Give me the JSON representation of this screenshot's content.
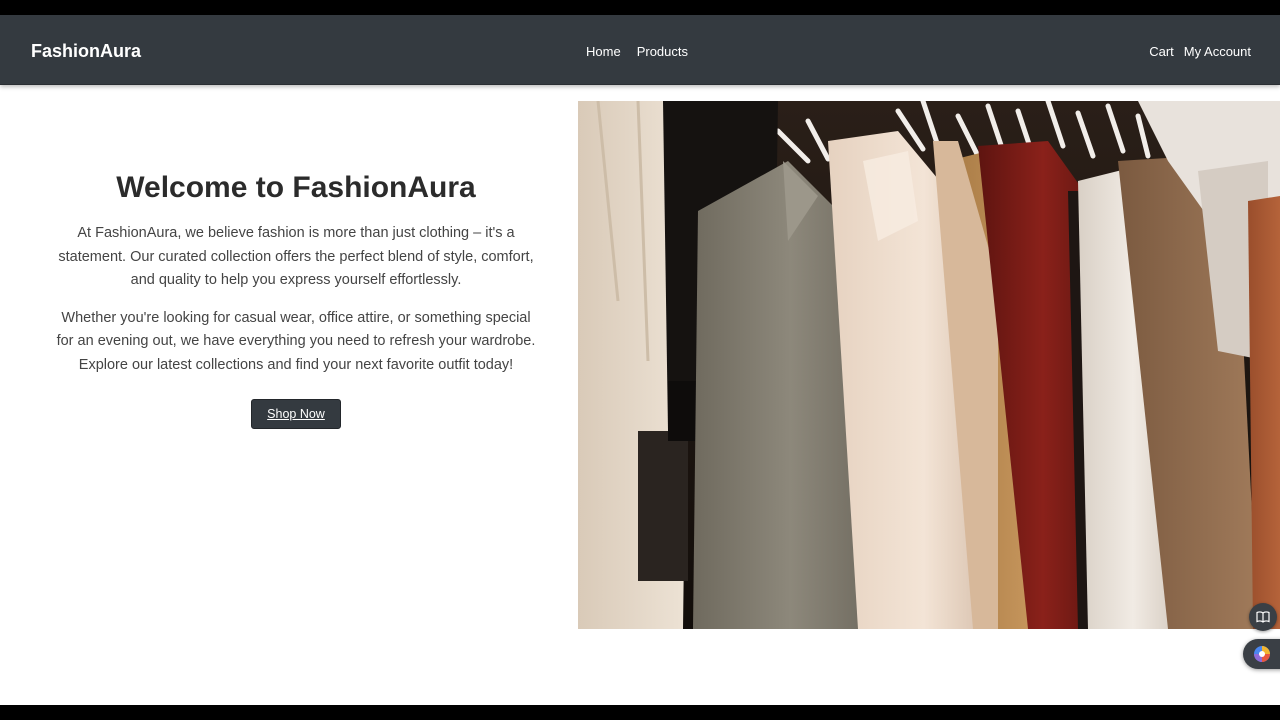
{
  "navbar": {
    "brand": "FashionAura",
    "center_links": [
      "Home",
      "Products"
    ],
    "right_links": [
      "Cart",
      "My Account"
    ]
  },
  "hero": {
    "title": "Welcome to FashionAura",
    "paragraphs": [
      "At FashionAura, we believe fashion is more than just clothing – it's a statement. Our curated collection offers the perfect blend of style, comfort, and quality to help you express yourself effortlessly.",
      "Whether you're looking for casual wear, office attire, or something special for an evening out, we have everything you need to refresh your wardrobe. Explore our latest collections and find your next favorite outfit today!"
    ],
    "cta_label": "Shop Now",
    "image_icon": "clothing-rack-photo"
  },
  "floating": {
    "reader_icon": "book-open-icon",
    "assistant_icon": "color-wheel-icon"
  },
  "colors": {
    "navbar_bg": "#343a40",
    "button_bg": "#343a40",
    "text": "#444444"
  }
}
